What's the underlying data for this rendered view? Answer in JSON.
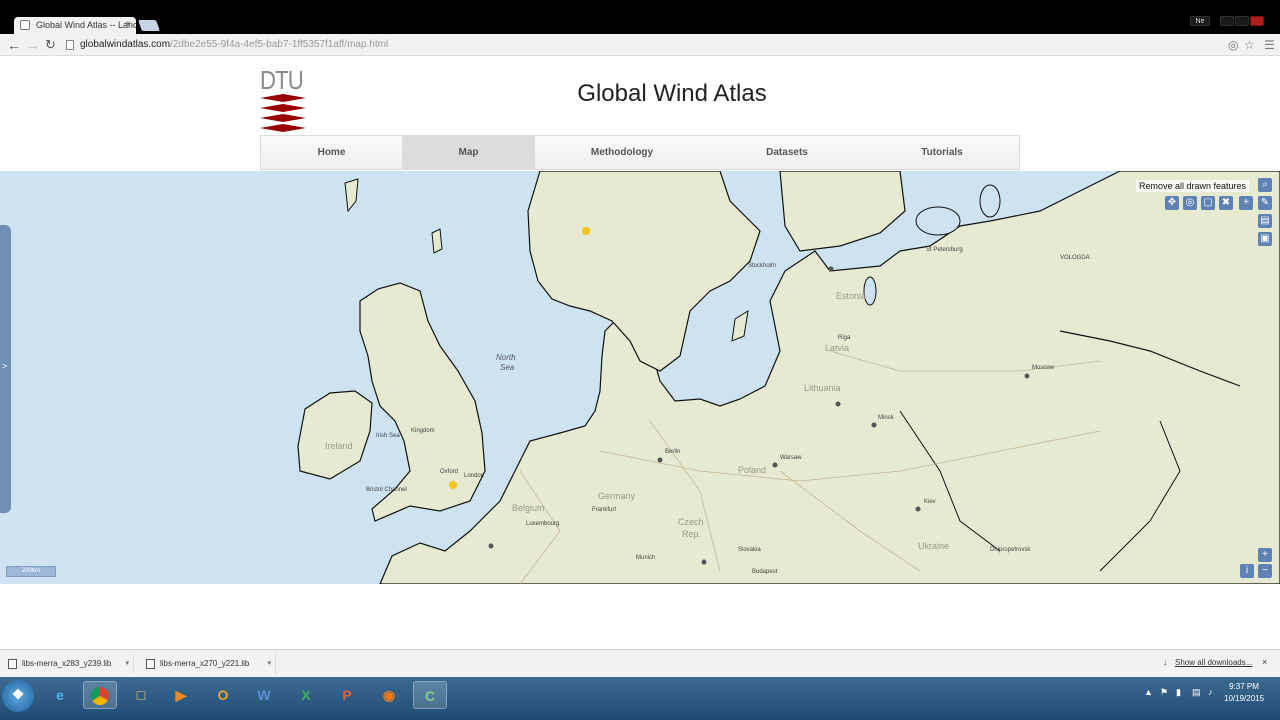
{
  "browser": {
    "tab_title": "Global Wind Atlas -- Lanc",
    "tab_close": "×",
    "url_host": "globalwindatlas.com",
    "url_path": "/2dbe2e55-9f4a-4ef5-bab7-1ff5357f1aff/map.html",
    "user_badge": "Ne"
  },
  "site": {
    "logo_text": "DTU",
    "title": "Global Wind Atlas",
    "nav": [
      {
        "label": "Home"
      },
      {
        "label": "Map"
      },
      {
        "label": "Methodology"
      },
      {
        "label": "Datasets"
      },
      {
        "label": "Tutorials"
      }
    ]
  },
  "map": {
    "tooltip": "Remove all drawn features",
    "scale_label": "200km",
    "side_handle": ">",
    "labels": {
      "north_sea_1": "North",
      "north_sea_2": "Sea",
      "germany": "Germany",
      "poland": "Poland",
      "belgium": "Belgium",
      "czech": "Czech",
      "rep": "Rep.",
      "ukraine": "Ukraine",
      "lithuania": "Lithuania",
      "latvia": "Latvia",
      "estonia": "Estonia",
      "ireland": "Ireland",
      "irish_sea": "Irish Sea",
      "bristol_channel": "Bristol Channel",
      "kingdom": "Kingdom",
      "london": "London",
      "oxford": "Oxford",
      "frankfurt": "Frankfurt",
      "warsaw": "Warsaw",
      "moscow": "Moscow",
      "st_petersburg": "St Petersburg",
      "kiev": "Kiev",
      "minsk": "Minsk",
      "berlin": "Berlin",
      "stockholm": "Stockholm",
      "riga": "Riga",
      "vologda": "VOLOGDA",
      "luxembourg": "Luxembourg",
      "budapest": "Budapest",
      "munich": "Munich",
      "dnipropetrovsk": "Dnipropetrovsk",
      "slovakia": "Slovakia"
    },
    "colors": {
      "sea": "#cde3f1",
      "land": "#e6ead0",
      "coast": "#111111",
      "marker": "#f5c518"
    }
  },
  "downloads": {
    "items": [
      {
        "name": "libs-merra_x283_y239.lib"
      },
      {
        "name": "libs-merra_x270_y221.lib"
      }
    ],
    "show_all": "Show all downloads...",
    "close": "×"
  },
  "taskbar": {
    "clock_time": "9:37 PM",
    "clock_date": "10/19/2015"
  }
}
